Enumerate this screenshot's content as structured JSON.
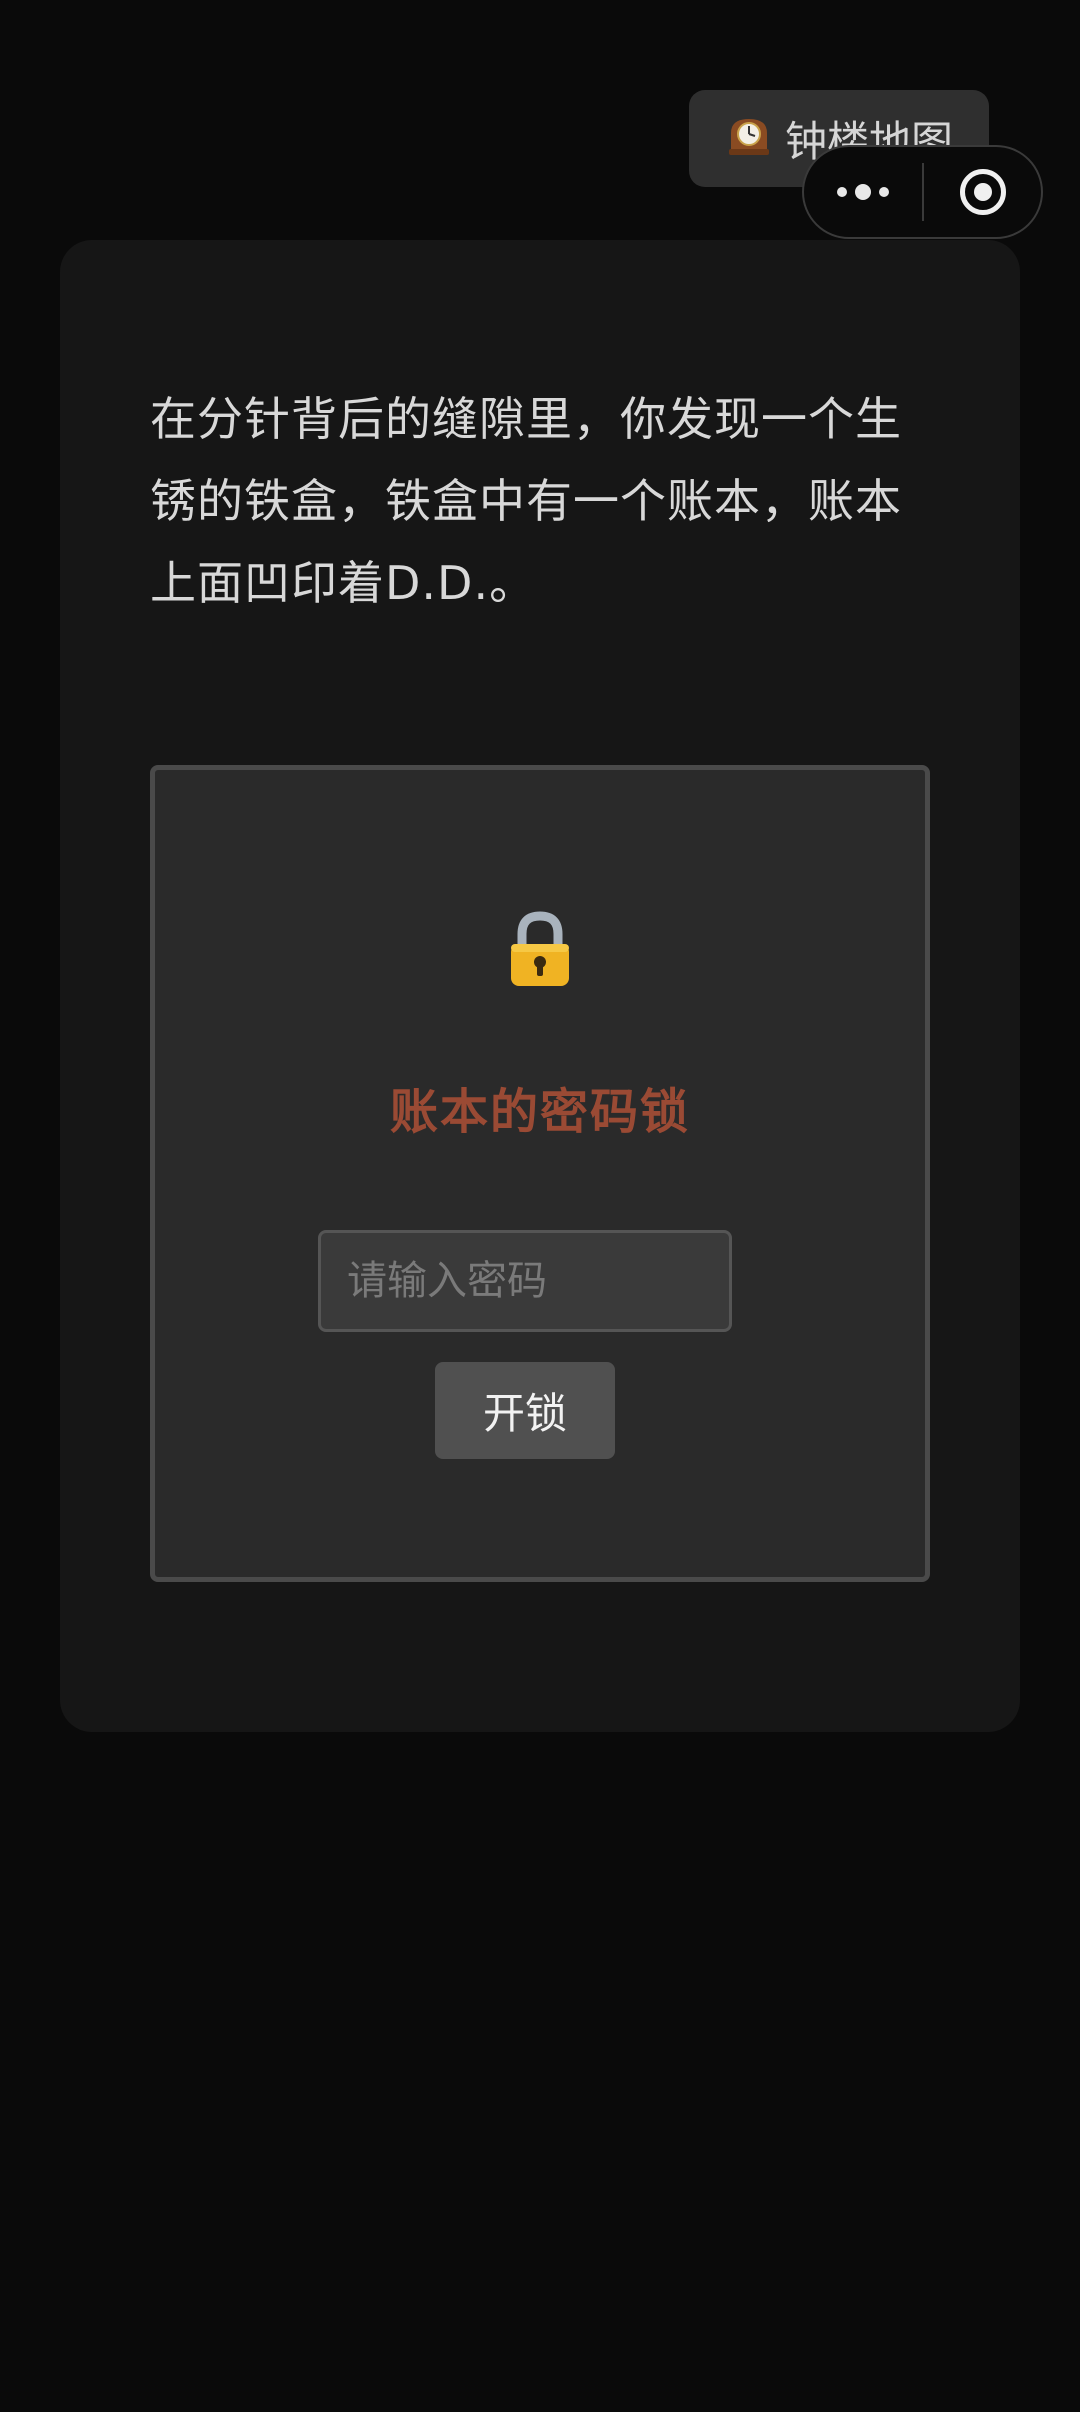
{
  "header": {
    "map_button": {
      "icon": "mantel-clock-icon",
      "label": "钟楼地图"
    },
    "capsule": {
      "more_icon": "more-dots-icon",
      "close_icon": "target-circle-icon"
    }
  },
  "story": {
    "text": "在分针背后的缝隙里，你发现一个生锈的铁盒，铁盒中有一个账本，账本上面凹印着D.D.。"
  },
  "lock": {
    "icon": "padlock-icon",
    "title": "账本的密码锁",
    "input_placeholder": "请输入密码",
    "input_value": "",
    "button_label": "开锁"
  },
  "colors": {
    "background": "#0a0a0a",
    "card": "#161616",
    "panel": "#2a2a2a",
    "title_accent": "#9a4a34"
  }
}
